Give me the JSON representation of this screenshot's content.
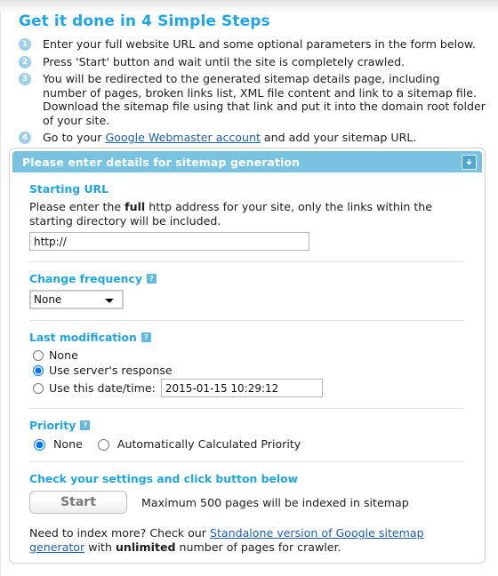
{
  "intro": {
    "title": "Get it done in 4 Simple Steps",
    "steps": [
      {
        "num": "1",
        "text": "Enter your full website URL and some optional parameters in the form below."
      },
      {
        "num": "2",
        "text": "Press 'Start' button and wait until the site is completely crawled."
      },
      {
        "num": "3",
        "text": "You will be redirected to the generated sitemap details page, including number of pages, broken links list, XML file content and link to a sitemap file. Download the sitemap file using that link and put it into the domain root folder of your site."
      },
      {
        "num": "4",
        "prefix": "Go to your ",
        "link": "Google Webmaster account",
        "suffix": " and add your sitemap URL."
      }
    ]
  },
  "panel": {
    "header_title": "Please enter details for sitemap generation",
    "collapse_icon": "arrow-down-box-icon",
    "starting_url": {
      "label": "Starting URL",
      "help_lead": "Please enter the ",
      "help_bold": "full",
      "help_rest": " http address for your site, only the links within the starting directory will be included.",
      "input_value": "http://",
      "input_placeholder": "http://"
    },
    "change_frequency": {
      "label": "Change frequency",
      "help_icon": "?",
      "selected": "None",
      "options": [
        "None"
      ]
    },
    "last_modification": {
      "label": "Last modification",
      "help_icon": "?",
      "options": [
        {
          "id": "lm-none",
          "label": "None",
          "checked": false
        },
        {
          "id": "lm-server",
          "label": "Use server's response",
          "checked": true
        },
        {
          "id": "lm-date",
          "label": "Use this date/time:",
          "checked": false
        }
      ],
      "date_value": "2015-01-15 10:29:12"
    },
    "priority": {
      "label": "Priority",
      "help_icon": "?",
      "options": [
        {
          "id": "pr-none",
          "label": "None",
          "checked": true
        },
        {
          "id": "pr-auto",
          "label": "Automatically Calculated Priority",
          "checked": false
        }
      ]
    },
    "submit": {
      "label": "Check your settings and click button below",
      "button_label": "Start",
      "note": "Maximum 500 pages will be indexed in sitemap"
    },
    "footer": {
      "lead": "Need to index more? Check our ",
      "link": "Standalone version of Google sitemap generator",
      "mid": " with ",
      "bold": "unlimited",
      "rest": " number of pages for crawler."
    }
  },
  "colors": {
    "accent_blue": "#21a5e2",
    "header_blue": "#79c3e0",
    "bullet_blue": "#9ecfe8",
    "link_blue": "#1c5fa8"
  }
}
